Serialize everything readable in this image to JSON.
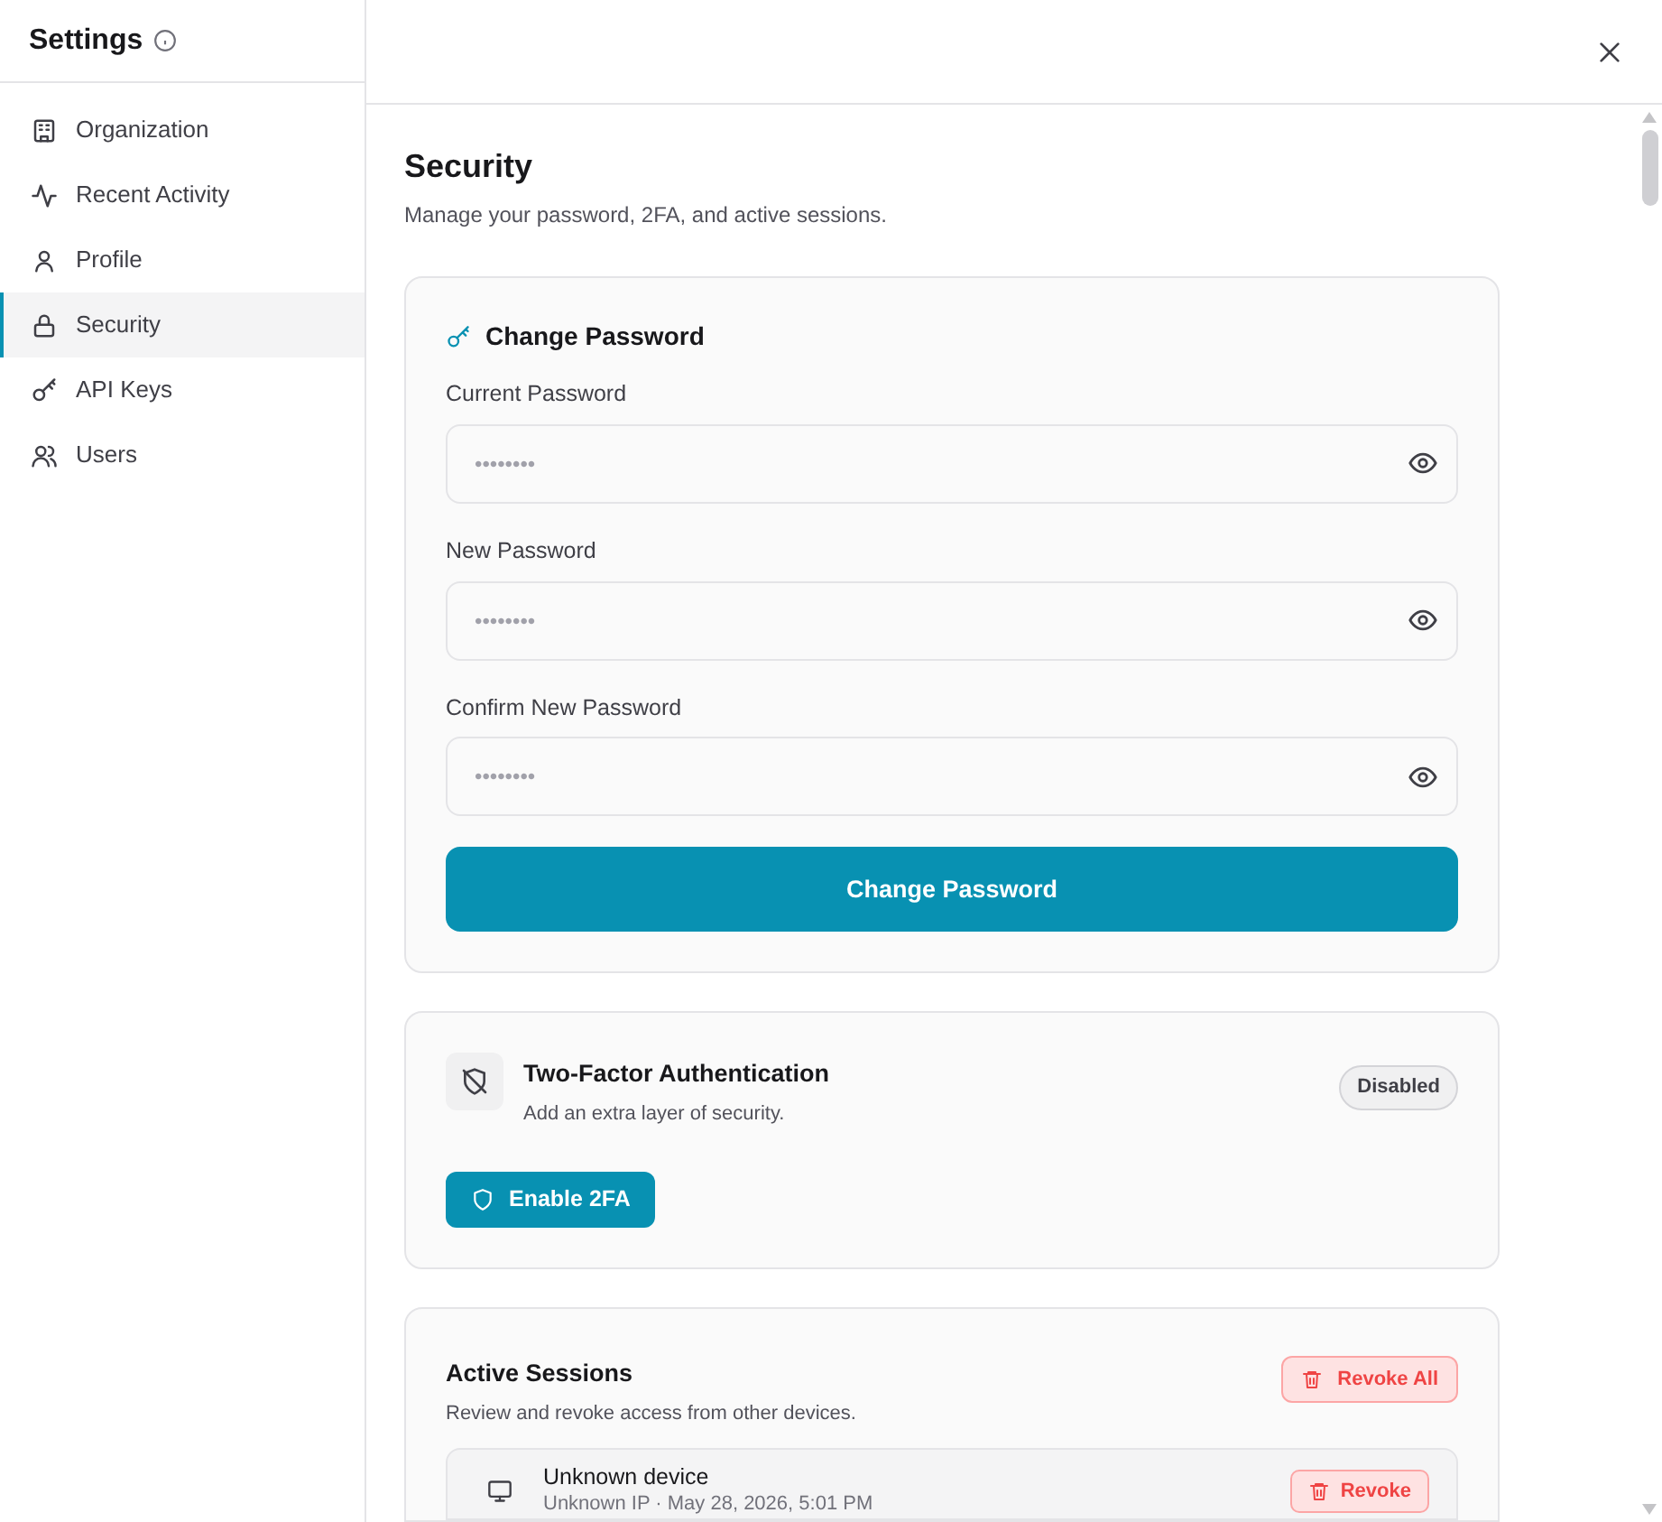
{
  "sidebar": {
    "title": "Settings",
    "items": [
      {
        "label": "Organization",
        "selected": false
      },
      {
        "label": "Recent Activity",
        "selected": false
      },
      {
        "label": "Profile",
        "selected": false
      },
      {
        "label": "Security",
        "selected": true
      },
      {
        "label": "API Keys",
        "selected": false
      },
      {
        "label": "Users",
        "selected": false
      }
    ]
  },
  "page": {
    "title": "Security",
    "subtitle": "Manage your password, 2FA, and active sessions."
  },
  "change_password": {
    "title": "Change Password",
    "fields": [
      {
        "label": "Current Password",
        "placeholder": "••••••••"
      },
      {
        "label": "New Password",
        "placeholder": "••••••••"
      },
      {
        "label": "Confirm New Password",
        "placeholder": "••••••••"
      }
    ],
    "button": "Change Password"
  },
  "two_factor": {
    "title": "Two-Factor Authentication",
    "subtitle": "Add an extra layer of security.",
    "enabled": false,
    "status": "Disabled",
    "button": "Enable 2FA"
  },
  "sessions": {
    "title": "Active Sessions",
    "subtitle": "Review and revoke access from other devices.",
    "revoke_all": "Revoke All",
    "items": [
      {
        "device": "Unknown device",
        "detail": "Unknown IP · May 28, 2026, 5:01 PM",
        "button": "Revoke"
      }
    ]
  }
}
